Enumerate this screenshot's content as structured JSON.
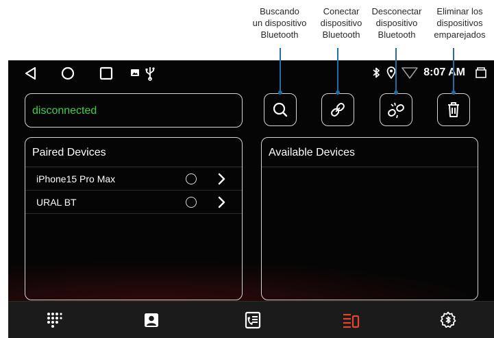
{
  "callouts": [
    {
      "lines": [
        "Buscando",
        "un dispositivo",
        "Bluetooth"
      ]
    },
    {
      "lines": [
        "Conectar",
        "dispositivo",
        "Bluetooth"
      ]
    },
    {
      "lines": [
        "Desconectar",
        "dispositivo",
        "Bluetooth"
      ]
    },
    {
      "lines": [
        "Eliminar los",
        "dispositivos",
        "emparejados"
      ]
    }
  ],
  "statusbar": {
    "time": "8:07 AM",
    "icons": [
      "back-icon",
      "home-icon",
      "recents-icon",
      "image-notification-icon",
      "usb-icon",
      "bluetooth-icon",
      "location-icon",
      "wifi-icon",
      "screenshot-icon"
    ]
  },
  "connection": {
    "status": "disconnected",
    "status_color": "#3fcf4a"
  },
  "toolbar": {
    "icons": [
      "search-icon",
      "link-icon",
      "unlink-icon",
      "trash-icon"
    ]
  },
  "paired": {
    "title": "Paired Devices",
    "devices": [
      {
        "name": "iPhone15 Pro Max"
      },
      {
        "name": "URAL BT"
      }
    ]
  },
  "available": {
    "title": "Available Devices",
    "devices": []
  },
  "bottom_nav": {
    "items": [
      "dialpad-icon",
      "contacts-icon",
      "call-log-icon",
      "bluetooth-devices-icon",
      "bluetooth-settings-icon"
    ],
    "active_color": "#e8452c"
  },
  "colors": {
    "accent_leader": "#1f6ea8",
    "background": "#050505",
    "border": "#d6d6d6"
  }
}
